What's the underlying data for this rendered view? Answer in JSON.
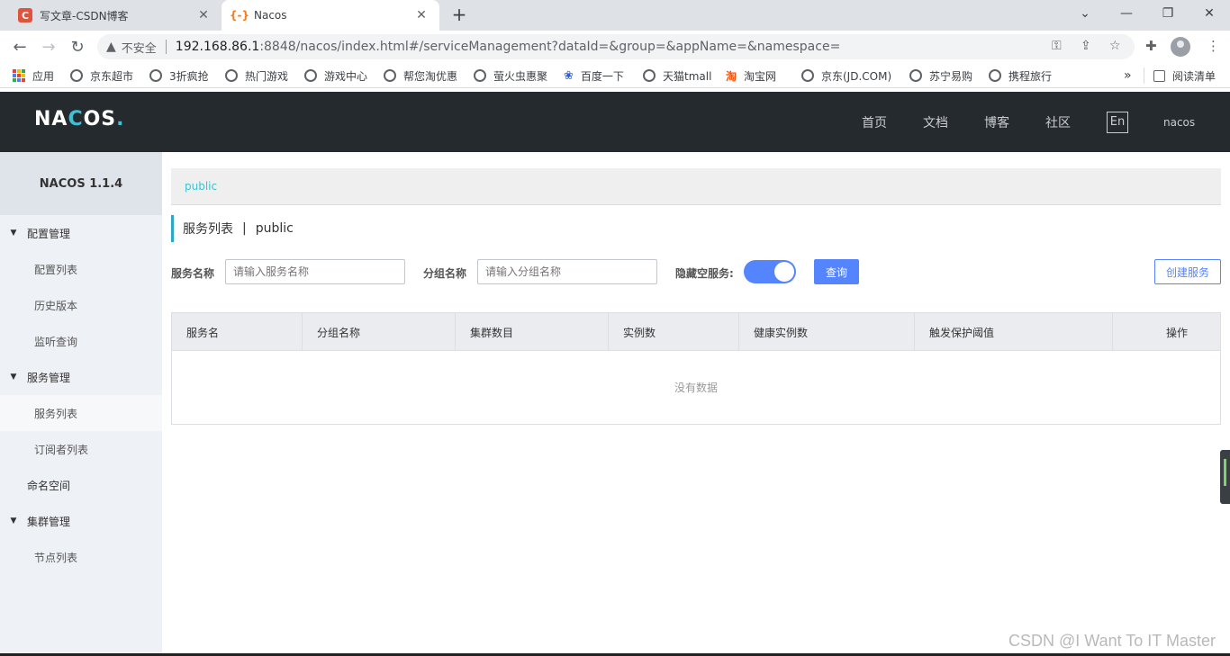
{
  "browser": {
    "tabs": [
      {
        "favicon": "C",
        "title": "写文章-CSDN博客"
      },
      {
        "favicon": "{-}",
        "title": "Nacos"
      }
    ],
    "new_tab": "+",
    "window_controls": [
      "minimize-icon",
      "restore-icon",
      "close-icon"
    ],
    "security_label": "不安全",
    "url_host": "192.168.86.1",
    "url_rest": ":8848/nacos/index.html#/serviceManagement?dataId=&group=&appName=&namespace=",
    "bookmarks": [
      "应用",
      "京东超市",
      "3折疯抢",
      "热门游戏",
      "游戏中心",
      "帮您淘优惠",
      "萤火虫惠聚",
      "百度一下",
      "天猫tmall",
      "淘宝网",
      "京东(JD.COM)",
      "苏宁易购",
      "携程旅行"
    ],
    "bookmarks_more": "»",
    "reading_list": "阅读清单"
  },
  "header": {
    "logo_a": "NA",
    "logo_b": "C",
    "logo_c": "OS",
    "logo_dot": ".",
    "nav": [
      "首页",
      "文档",
      "博客",
      "社区"
    ],
    "lang": "En",
    "user": "nacos"
  },
  "sidebar": {
    "version": "NACOS 1.1.4",
    "groups": [
      {
        "label": "配置管理",
        "items": [
          "配置列表",
          "历史版本",
          "监听查询"
        ]
      },
      {
        "label": "服务管理",
        "items": [
          "服务列表",
          "订阅者列表"
        ]
      },
      {
        "label": "命名空间",
        "items": []
      },
      {
        "label": "集群管理",
        "items": [
          "节点列表"
        ]
      }
    ]
  },
  "main": {
    "namespace": "public",
    "title": "服务列表",
    "title_sep": "|",
    "title_ns": "public",
    "filters": {
      "service_label": "服务名称",
      "service_placeholder": "请输入服务名称",
      "group_label": "分组名称",
      "group_placeholder": "请输入分组名称",
      "hide_empty_label": "隐藏空服务:",
      "hide_empty_on": true,
      "query_button": "查询",
      "create_button": "创建服务"
    },
    "table": {
      "columns": [
        "服务名",
        "分组名称",
        "集群数目",
        "实例数",
        "健康实例数",
        "触发保护阈值",
        "操作"
      ],
      "rows": [],
      "empty_text": "没有数据"
    }
  },
  "watermark": "CSDN @I Want To IT Master",
  "colors": {
    "header_bg": "#252a2f",
    "accent": "#3ec1d3",
    "primary": "#5584ff",
    "sidebar_bg": "#eef1f5"
  }
}
